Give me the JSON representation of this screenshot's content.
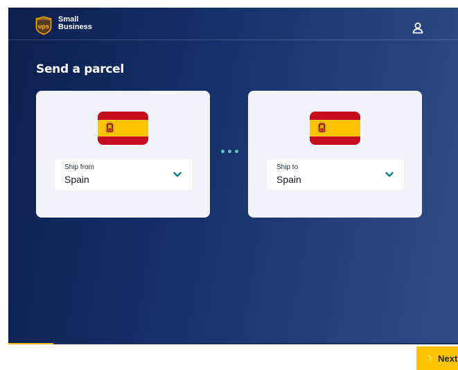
{
  "header": {
    "brand_line1": "Small",
    "brand_line2": "Business",
    "user_icon": "user-icon",
    "logo_icon": "ups-shield-logo"
  },
  "page": {
    "title": "Send a parcel"
  },
  "ship_from": {
    "label": "Ship from",
    "value": "Spain",
    "flag": "spain-flag",
    "chevron": "chevron-down-icon"
  },
  "ship_to": {
    "label": "Ship to",
    "value": "Spain",
    "flag": "spain-flag",
    "chevron": "chevron-down-icon"
  },
  "connector": {
    "icon": "dots-connector"
  },
  "progress": {
    "value": 0.1
  },
  "footer": {
    "next_label": "Next",
    "next_icon": "chevron-right-icon"
  },
  "colors": {
    "accent": "#ffc400",
    "teal": "#0a8080",
    "dots": "#5fc3c3",
    "flag_red": "#c60b1e",
    "flag_yellow": "#ffc400",
    "ups_brown": "#5a3a1c"
  }
}
